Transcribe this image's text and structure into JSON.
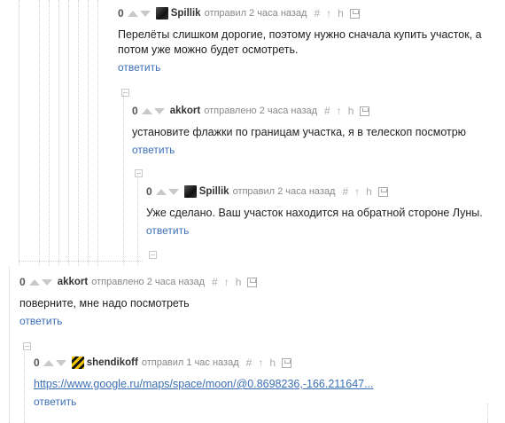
{
  "comments": [
    {
      "score": "0",
      "author": "Spillik",
      "action": "отправил 2 часа назад",
      "text": "Перелёты слишком дорогие, поэтому нужно сначала купить участок, а потом уже можно будет осмотреть.",
      "reply": "ответить",
      "avatar": "dark-avatar"
    },
    {
      "score": "0",
      "author": "akkort",
      "action": "отправлено 2 часа назад",
      "text": "установите флажки по границам участка, я в телескоп посмотрю",
      "reply": "ответить"
    },
    {
      "score": "0",
      "author": "Spillik",
      "action": "отправил 2 часа назад",
      "text": "Уже сделано. Ваш участок находится на обратной стороне Луны.",
      "reply": "ответить",
      "avatar": "dark-avatar"
    },
    {
      "score": "0",
      "author": "akkort",
      "action": "отправлено 2 часа назад",
      "text": "поверните, мне надо посмотреть",
      "reply": "ответить"
    },
    {
      "score": "0",
      "author": "shendikoff",
      "action": "отправил 1 час назад",
      "link": "https://www.google.ru/maps/space/moon/@0.8698236,-166.211647...",
      "reply": "ответить",
      "avatar": "hazard-stripe-avatar"
    }
  ],
  "tools": {
    "hash": "#",
    "parent": "↑",
    "branch": "h"
  },
  "icons": {
    "vote_up": "triangle-up-icon",
    "vote_down": "triangle-down-icon",
    "collapse": "minus-box-icon",
    "save": "floppy-icon"
  },
  "colors": {
    "link": "#3b6fb6",
    "meta": "#888888",
    "vote": "#c9c9c9"
  }
}
